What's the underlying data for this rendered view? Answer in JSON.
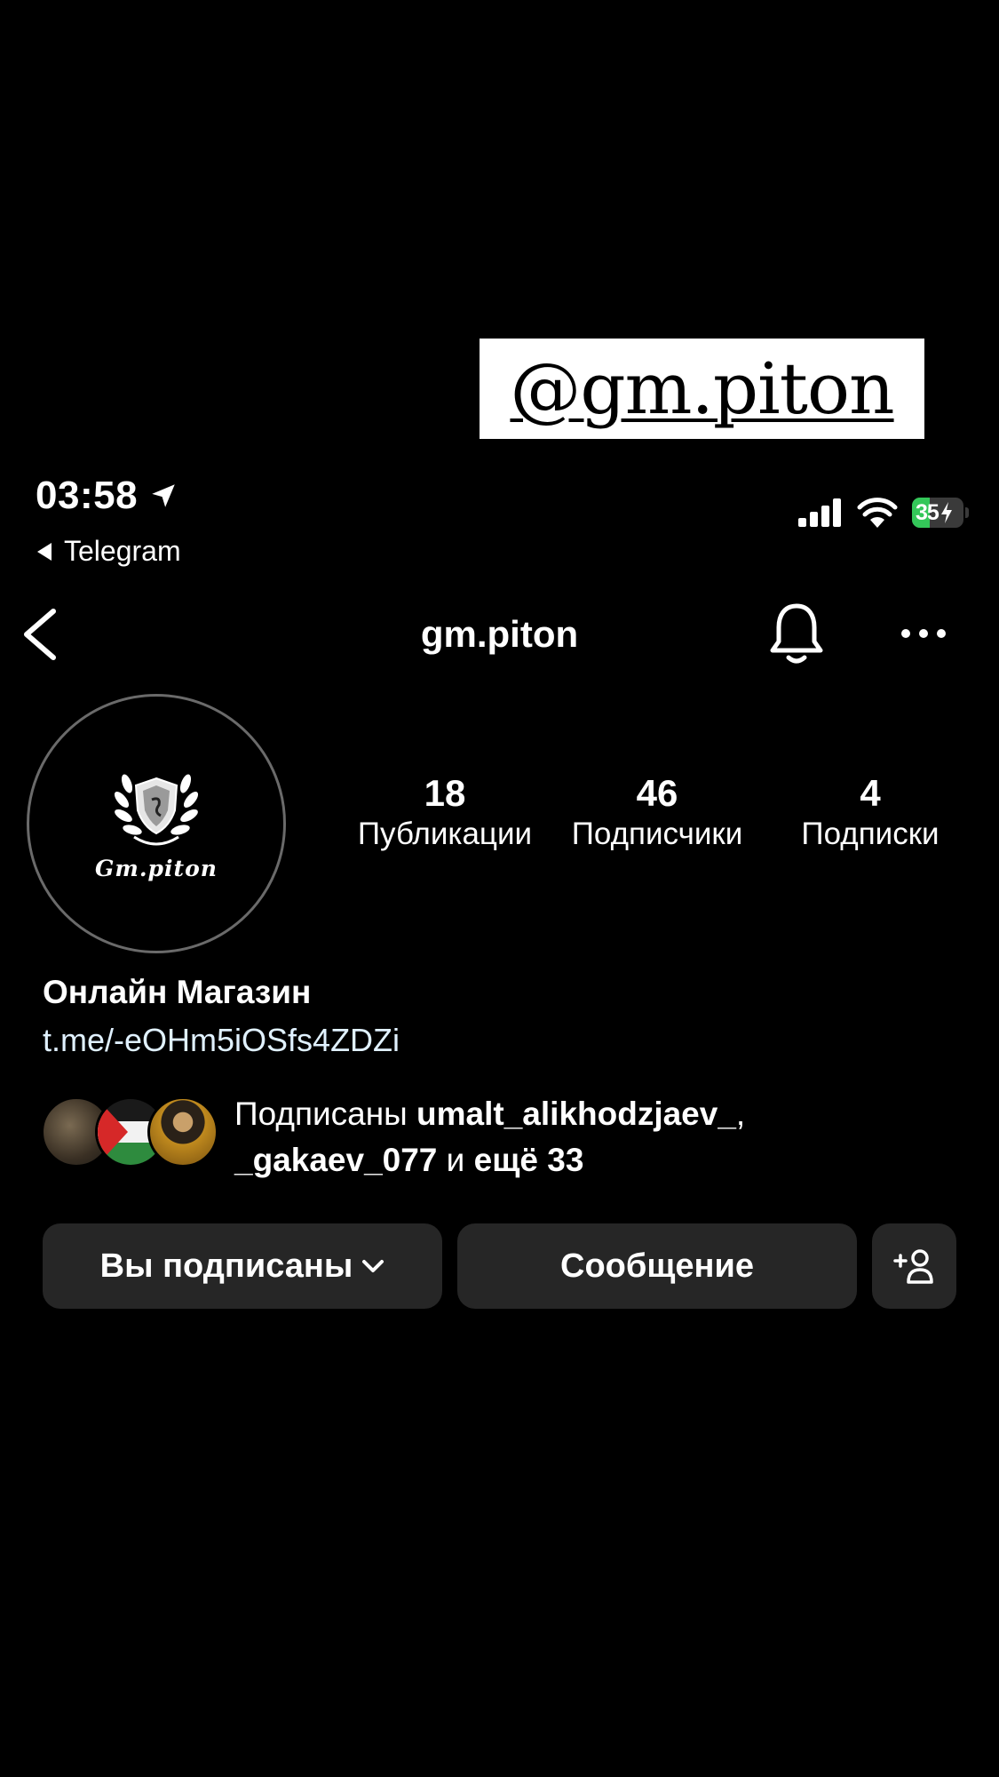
{
  "sticker": {
    "text": "@gm.piton"
  },
  "status_bar": {
    "time": "03:58",
    "back_app": "Telegram",
    "battery_level": "35",
    "battery_fraction": 0.35
  },
  "header": {
    "title": "gm.piton"
  },
  "profile": {
    "avatar_text": "Gm.piton",
    "stats": [
      {
        "count": "18",
        "label": "Публикации"
      },
      {
        "count": "46",
        "label": "Подписчики"
      },
      {
        "count": "4",
        "label": "Подписки"
      }
    ],
    "name": "Онлайн Магазин",
    "link": "t.me/-eOHm5iOSfs4ZDZi"
  },
  "followed_by": {
    "prefix": "Подписаны ",
    "user1": "umalt_alikhodzjaev_",
    "sep": ",",
    "user2": "_gakaev_077",
    "middle": " и ",
    "rest": "ещё 33"
  },
  "actions": {
    "following_label": "Вы подписаны",
    "message_label": "Сообщение"
  }
}
